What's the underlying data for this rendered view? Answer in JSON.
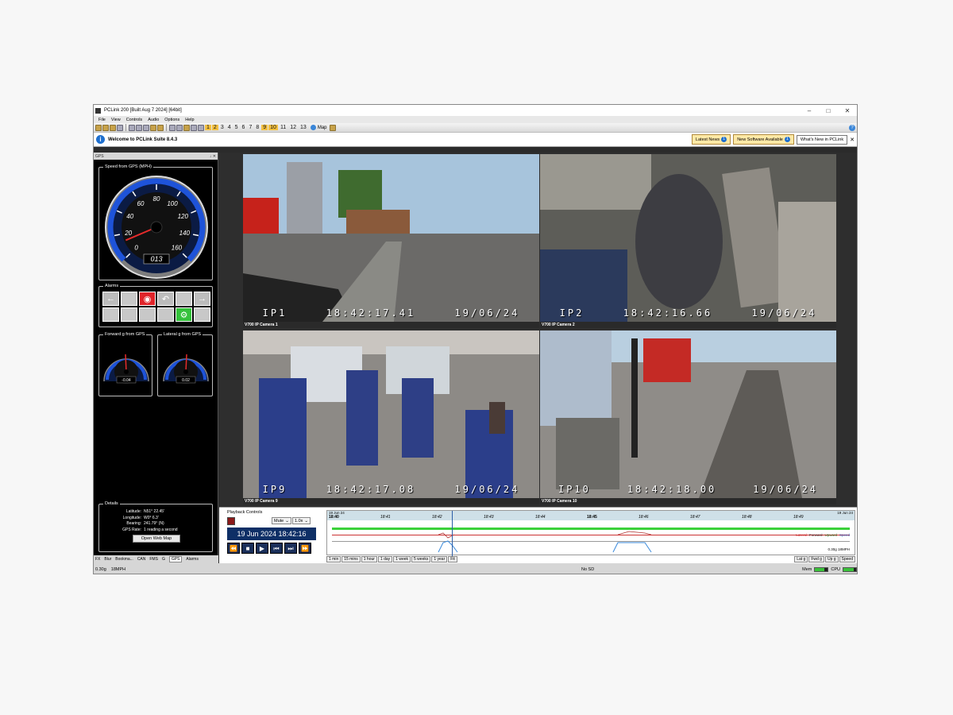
{
  "window": {
    "title": "PCLink 200 [Built Aug  7 2024] [64bit]",
    "controls": [
      "–",
      "□",
      "✕"
    ]
  },
  "menu": [
    "File",
    "View",
    "Controls",
    "Audio",
    "Options",
    "Help"
  ],
  "toolbar": {
    "layouts": [
      "1",
      "2",
      "3",
      "4",
      "5",
      "6",
      "7",
      "8",
      "9",
      "10",
      "11",
      "12",
      "13"
    ],
    "map_label": "Map"
  },
  "news": {
    "welcome": "Welcome to PCLink Suite 8.4.3",
    "latest": "Latest News",
    "latest_count": "1",
    "software": "New Software Available",
    "software_count": "1",
    "whats_new": "What's New in PCLink"
  },
  "left_panel": {
    "header": "GPS",
    "header_ctrls": "↓ ✕",
    "speed_title": "Speed from GPS (MPH)",
    "speed_reading": "013",
    "speed_value_mph": 13,
    "speed_ticks": [
      "0",
      "20",
      "40",
      "60",
      "80",
      "100",
      "120",
      "140",
      "160"
    ],
    "alarms_title": "Alarms",
    "forward_title": "Forward g from GPS",
    "forward_value": "-0.04",
    "lateral_title": "Lateral g from GPS",
    "lateral_value": "0.02",
    "details_title": "Details",
    "details": [
      {
        "label": "Latitude:",
        "value": "N51° 22.45'"
      },
      {
        "label": "Longitude:",
        "value": "W0° 6.3'"
      },
      {
        "label": "Bearing:",
        "value": "241.79° (N)"
      },
      {
        "label": "GPS Rate:",
        "value": "1 reading a second"
      }
    ],
    "open_map": "Open Web Map",
    "tabs": [
      "FX",
      "Blur",
      "Bookma...",
      "CAN",
      "FMS",
      "G",
      "GPS",
      "Alarms"
    ]
  },
  "cameras": [
    {
      "id": "IP1",
      "time": "18:42:17.41",
      "date": "19/06/24",
      "label": "V700 IP Camera 1"
    },
    {
      "id": "IP2",
      "time": "18:42:16.66",
      "date": "19/06/24",
      "label": "V700 IP Camera 2"
    },
    {
      "id": "IP9",
      "time": "18:42:17.08",
      "date": "19/06/24",
      "label": "V700 IP Camera 9"
    },
    {
      "id": "IP10",
      "time": "18:42:18.00",
      "date": "19/06/24",
      "label": "V700 IP Camera 10"
    }
  ],
  "playback": {
    "title": "Playback Controls",
    "mute": "Mute",
    "speed": "1.0x",
    "datetime": "19 Jun 2024  18:42:16",
    "transport": [
      "⏪",
      "■",
      "▶",
      "⏮",
      "⏭",
      "⏩"
    ],
    "timeline_date_left": "19 Jun 24",
    "timeline_date_right": "19 Jun 24",
    "ticks": [
      "18:40",
      "18:41",
      "18:42",
      "18:43",
      "18:44",
      "18:45",
      "18:46",
      "18:47",
      "18:48",
      "18:49"
    ],
    "legend": [
      "Lateral",
      "Forward",
      "Upward",
      "Speed"
    ],
    "scale": "0.30g  18MPH",
    "ranges": [
      "1 min",
      "15 mins",
      "1 hour",
      "1 day",
      "1 week",
      "5 weeks",
      "1 year",
      "Fit"
    ],
    "channels": [
      "Lat g",
      "Fwd g",
      "Up g",
      "Speed"
    ]
  },
  "status": {
    "g": "0.30g",
    "mph": "18MPH",
    "center": "No SD",
    "mem": "Mem",
    "cpu": "CPU"
  },
  "colors": {
    "accent": "#0e2f66",
    "alarm_red": "#e0242a",
    "alarm_green": "#35c23c",
    "timeline_green": "#3bd13b"
  }
}
